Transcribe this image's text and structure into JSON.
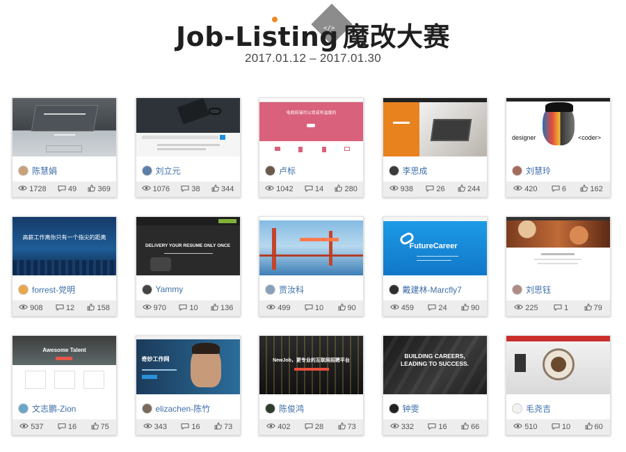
{
  "page": {
    "title_latin": "Job-Listing",
    "title_cjk": "魔改大赛",
    "logo_code": "</>",
    "date_range": "2017.01.12 – 2017.01.30",
    "accent_color": "#f08a24",
    "logo_gray": "#8c8c8c"
  },
  "cards": [
    {
      "name": "陈慧娟",
      "views": "1728",
      "comments": "49",
      "likes": "369",
      "thumb": "laptop-dark",
      "avatar": "#c9a27a"
    },
    {
      "name": "刘立元",
      "views": "1076",
      "comments": "38",
      "likes": "344",
      "thumb": "desk-dark",
      "avatar": "#5b7fa6"
    },
    {
      "name": "卢标",
      "views": "1042",
      "comments": "14",
      "likes": "280",
      "thumb": "pink-hero",
      "avatar": "#6a5a4a",
      "thumb_title": "电商前端可以变成有温度的"
    },
    {
      "name": "李思成",
      "views": "938",
      "comments": "26",
      "likes": "244",
      "thumb": "orange-office",
      "avatar": "#3a3a3a"
    },
    {
      "name": "刘慧玲",
      "views": "420",
      "comments": "6",
      "likes": "162",
      "thumb": "designer-coder",
      "avatar": "#a56b5c",
      "thumb_left": "designer",
      "thumb_right": "<coder>"
    },
    {
      "name": "forrest-党明",
      "views": "908",
      "comments": "12",
      "likes": "158",
      "thumb": "city-blue",
      "avatar": "#e9a64b",
      "thumb_title": "高薪工作离你只有一个指尖的距离"
    },
    {
      "name": "Yammy",
      "views": "970",
      "comments": "10",
      "likes": "136",
      "thumb": "resume-dark",
      "avatar": "#444444",
      "thumb_title": "DELIVERY YOUR RESUME ONLY ONCE"
    },
    {
      "name": "贾汝科",
      "views": "499",
      "comments": "10",
      "likes": "90",
      "thumb": "bridge",
      "avatar": "#8aa0b8"
    },
    {
      "name": "戴建林-Marcfly7",
      "views": "459",
      "comments": "24",
      "likes": "90",
      "thumb": "future-career",
      "avatar": "#2f2f2f",
      "thumb_title": "FutureCareer"
    },
    {
      "name": "刘思钰",
      "views": "225",
      "comments": "1",
      "likes": "79",
      "thumb": "bokeh",
      "avatar": "#b08a84"
    },
    {
      "name": "文志鹏-Zion",
      "views": "537",
      "comments": "16",
      "likes": "75",
      "thumb": "awesome-talent",
      "avatar": "#6aa6c8",
      "thumb_title": "Awesome Talent"
    },
    {
      "name": "elizachen-陈竹",
      "views": "343",
      "comments": "16",
      "likes": "73",
      "thumb": "portrait-blue",
      "avatar": "#7b6a5c",
      "thumb_title": "奇妙工作网"
    },
    {
      "name": "陈俊鸿",
      "views": "402",
      "comments": "28",
      "likes": "73",
      "thumb": "newjob-night",
      "avatar": "#2e3b2e",
      "thumb_title": "NewJob，更专业的互联网招聘平台"
    },
    {
      "name": "钟雯",
      "views": "332",
      "comments": "16",
      "likes": "66",
      "thumb": "building-careers",
      "avatar": "#222222",
      "thumb_title": "BUILDING CAREERS, LEADING TO SUCCESS."
    },
    {
      "name": "毛尧吉",
      "views": "510",
      "comments": "10",
      "likes": "60",
      "thumb": "coffee-white",
      "avatar": "#f2f2f2"
    }
  ]
}
